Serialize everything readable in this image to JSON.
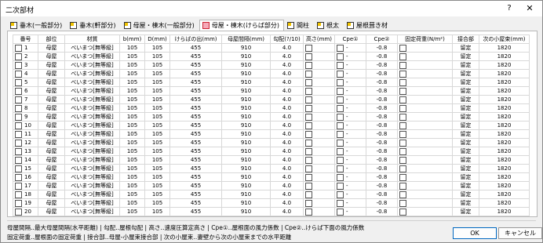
{
  "window": {
    "title": "二次部材",
    "help_label": "?",
    "close_label": "✕"
  },
  "tabs": [
    {
      "label": "垂木(一般部分)"
    },
    {
      "label": "垂木(軒部分)"
    },
    {
      "label": "母屋・棟木(一般部分)"
    },
    {
      "label": "母屋・棟木(けらば部分)"
    },
    {
      "label": "間柱"
    },
    {
      "label": "根太"
    },
    {
      "label": "屋根葺き材"
    }
  ],
  "table": {
    "headers": [
      "番号",
      "部位",
      "材質",
      "b(mm)",
      "D(mm)",
      "けらばの出(mm)",
      "母屋間隔(mm)",
      "勾配(?/10)",
      "高さ(mm)",
      "Cpe①",
      "Cpe②",
      "固定荷重(N/m²)",
      "接合部",
      "次の小屋束(mm)"
    ],
    "rows": [
      [
        "1",
        "母屋",
        "べいまつ[無等級]",
        "105",
        "105",
        "455",
        "910",
        "4.0",
        "-",
        "-0.8",
        "留定",
        "1820"
      ],
      [
        "2",
        "母屋",
        "べいまつ[無等級]",
        "105",
        "105",
        "455",
        "910",
        "4.0",
        "-",
        "-0.8",
        "留定",
        "1820"
      ],
      [
        "3",
        "母屋",
        "べいまつ[無等級]",
        "105",
        "105",
        "455",
        "910",
        "4.0",
        "-",
        "-0.8",
        "留定",
        "1820"
      ],
      [
        "4",
        "母屋",
        "べいまつ[無等級]",
        "105",
        "105",
        "455",
        "910",
        "4.0",
        "-",
        "-0.8",
        "留定",
        "1820"
      ],
      [
        "5",
        "母屋",
        "べいまつ[無等級]",
        "105",
        "105",
        "455",
        "910",
        "4.0",
        "-",
        "-0.8",
        "留定",
        "1820"
      ],
      [
        "6",
        "母屋",
        "べいまつ[無等級]",
        "105",
        "105",
        "455",
        "910",
        "4.0",
        "-",
        "-0.8",
        "留定",
        "1820"
      ],
      [
        "7",
        "母屋",
        "べいまつ[無等級]",
        "105",
        "105",
        "455",
        "910",
        "4.0",
        "-",
        "-0.8",
        "留定",
        "1820"
      ],
      [
        "8",
        "母屋",
        "べいまつ[無等級]",
        "105",
        "105",
        "455",
        "910",
        "4.0",
        "-",
        "-0.8",
        "留定",
        "1820"
      ],
      [
        "9",
        "母屋",
        "べいまつ[無等級]",
        "105",
        "105",
        "455",
        "910",
        "4.0",
        "-",
        "-0.8",
        "留定",
        "1820"
      ],
      [
        "10",
        "母屋",
        "べいまつ[無等級]",
        "105",
        "105",
        "455",
        "910",
        "4.0",
        "-",
        "-0.8",
        "留定",
        "1820"
      ],
      [
        "11",
        "母屋",
        "べいまつ[無等級]",
        "105",
        "105",
        "455",
        "910",
        "4.0",
        "-",
        "-0.8",
        "留定",
        "1820"
      ],
      [
        "12",
        "母屋",
        "べいまつ[無等級]",
        "105",
        "105",
        "455",
        "910",
        "4.0",
        "-",
        "-0.8",
        "留定",
        "1820"
      ],
      [
        "13",
        "母屋",
        "べいまつ[無等級]",
        "105",
        "105",
        "455",
        "910",
        "4.0",
        "-",
        "-0.8",
        "留定",
        "1820"
      ],
      [
        "14",
        "母屋",
        "べいまつ[無等級]",
        "105",
        "105",
        "455",
        "910",
        "4.0",
        "-",
        "-0.8",
        "留定",
        "1820"
      ],
      [
        "15",
        "母屋",
        "べいまつ[無等級]",
        "105",
        "105",
        "455",
        "910",
        "4.0",
        "-",
        "-0.8",
        "留定",
        "1820"
      ],
      [
        "16",
        "母屋",
        "べいまつ[無等級]",
        "105",
        "105",
        "455",
        "910",
        "4.0",
        "-",
        "-0.8",
        "留定",
        "1820"
      ],
      [
        "17",
        "母屋",
        "べいまつ[無等級]",
        "105",
        "105",
        "455",
        "910",
        "4.0",
        "-",
        "-0.8",
        "留定",
        "1820"
      ],
      [
        "18",
        "母屋",
        "べいまつ[無等級]",
        "105",
        "105",
        "455",
        "910",
        "4.0",
        "-",
        "-0.8",
        "留定",
        "1820"
      ],
      [
        "19",
        "母屋",
        "べいまつ[無等級]",
        "105",
        "105",
        "455",
        "910",
        "4.0",
        "-",
        "-0.8",
        "留定",
        "1820"
      ],
      [
        "20",
        "母屋",
        "べいまつ[無等級]",
        "105",
        "105",
        "455",
        "910",
        "4.0",
        "-",
        "-0.8",
        "留定",
        "1820"
      ]
    ]
  },
  "notes": {
    "line1": "母屋間隔‥最大母屋間隔(水平距離)  |  勾配‥屋根勾配  |  高さ‥速度圧算定高さ  |  Cpe①‥屋根面の風力係数  |  Cpe②‥けらば下面の風力係数",
    "line2": "固定荷重‥屋根面の固定荷重  |  接合部‥母屋-小屋束接合部  |  次の小屋束‥妻壁から次の小屋束までの水平距離"
  },
  "buttons": {
    "ok": "OK",
    "cancel": "キャンセル"
  }
}
